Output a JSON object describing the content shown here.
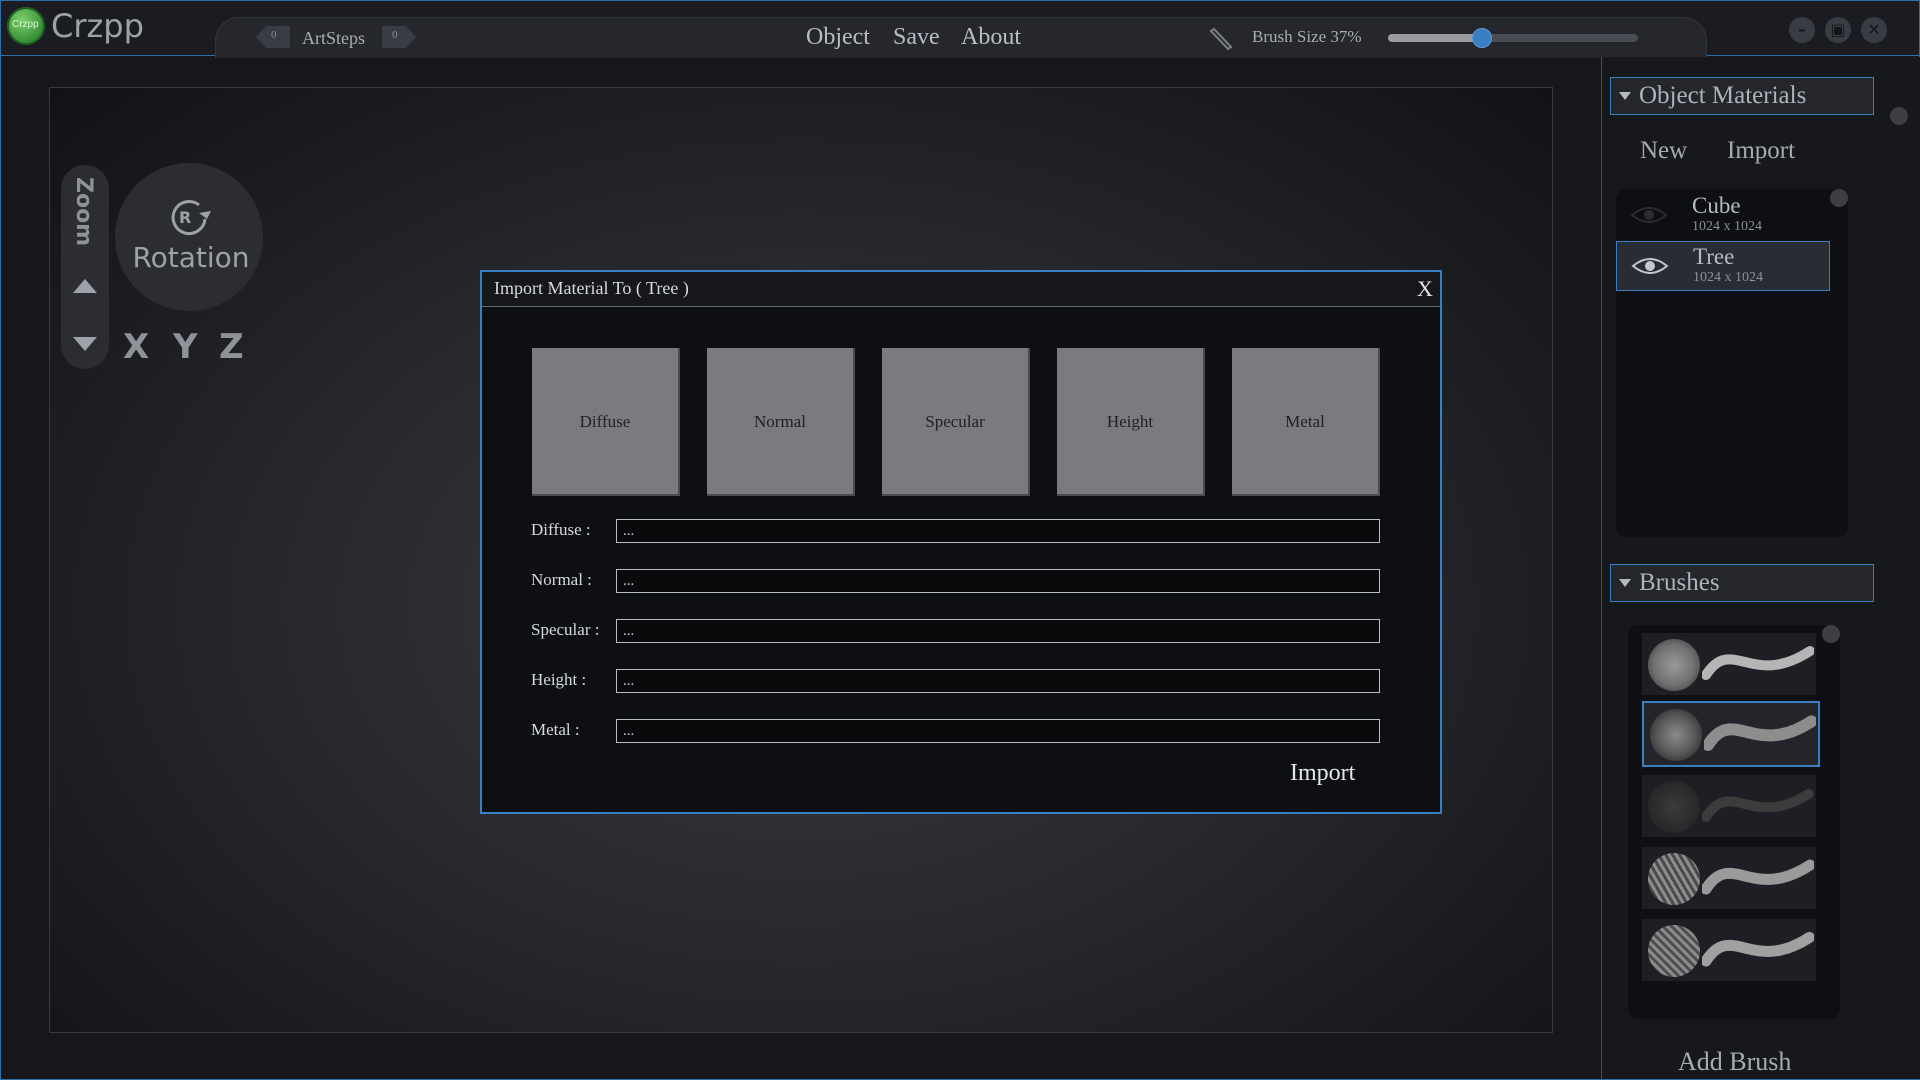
{
  "app": {
    "name": "Crzpp",
    "logo_text": "Crzpp"
  },
  "toolbar": {
    "history": {
      "undo_count": "0",
      "label": "ArtSteps",
      "redo_count": "0"
    },
    "menu": [
      "Object",
      "Save",
      "About"
    ],
    "brush_size_label": "Brush Size 37%",
    "brush_size_value": 0.37
  },
  "window_controls": {
    "minimize_icon": "minimize-icon",
    "maximize_icon": "maximize-icon",
    "close_icon": "close-icon"
  },
  "viewport": {
    "zoom_label": "Zoom",
    "rotation_label": "Rotation",
    "rotation_badge": "R",
    "axes": [
      "X",
      "Y",
      "Z"
    ]
  },
  "dialog": {
    "title": "Import Material To ( Tree )",
    "close_label": "X",
    "slots": [
      "Diffuse",
      "Normal",
      "Specular",
      "Height",
      "Metal"
    ],
    "fields": [
      {
        "label": "Diffuse :",
        "value": "..."
      },
      {
        "label": "Normal :",
        "value": "..."
      },
      {
        "label": "Specular :",
        "value": "..."
      },
      {
        "label": "Height :",
        "value": "..."
      },
      {
        "label": "Metal :",
        "value": "..."
      }
    ],
    "import_label": "Import"
  },
  "panel": {
    "materials": {
      "title": "Object Materials",
      "new_label": "New",
      "import_label": "Import",
      "items": [
        {
          "name": "Cube",
          "size": "1024 x 1024",
          "visible": false,
          "selected": false
        },
        {
          "name": "Tree",
          "size": "1024 x 1024",
          "visible": true,
          "selected": true
        }
      ]
    },
    "brushes": {
      "title": "Brushes",
      "add_label": "Add Brush",
      "items": [
        {
          "name": "soft-round",
          "selected": false
        },
        {
          "name": "rough-texture",
          "selected": true
        },
        {
          "name": "noise-grain",
          "selected": false
        },
        {
          "name": "fiber",
          "selected": false
        },
        {
          "name": "crosshatch",
          "selected": false
        }
      ]
    }
  },
  "colors": {
    "accent": "#3b7fc3",
    "background": "#16171b",
    "slot_gray": "#7a7b7e",
    "logo_green": "#4caf3c"
  }
}
